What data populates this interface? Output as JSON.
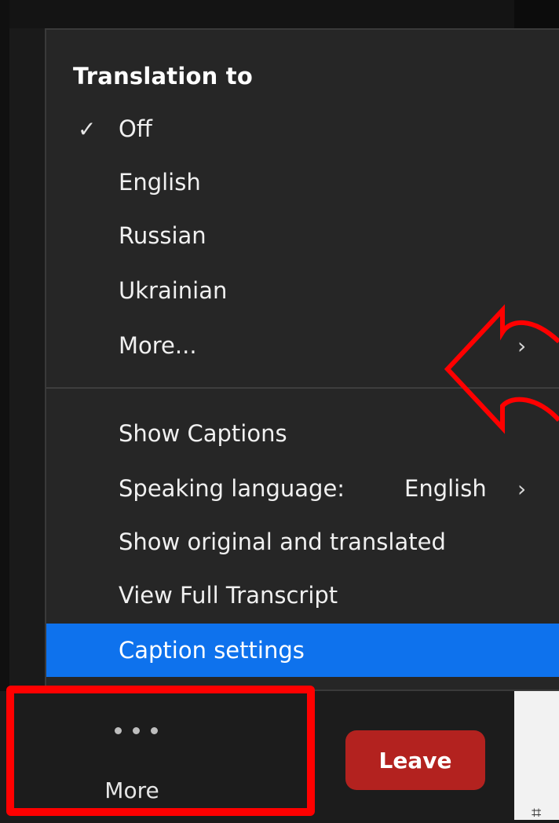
{
  "menu": {
    "header": "Translation to",
    "translation_options": [
      {
        "label": "Off",
        "checked": true
      },
      {
        "label": "English",
        "checked": false
      },
      {
        "label": "Russian",
        "checked": false
      },
      {
        "label": "Ukrainian",
        "checked": false
      },
      {
        "label": "More...",
        "checked": false,
        "has_submenu": true
      }
    ],
    "caption_items": [
      {
        "label": "Show Captions"
      },
      {
        "label": "Speaking language:",
        "value": "English",
        "has_submenu": true
      },
      {
        "label": "Show original and translated"
      },
      {
        "label": "View Full Transcript"
      },
      {
        "label": "Caption settings",
        "selected": true
      }
    ]
  },
  "toolbar": {
    "more_label": "More",
    "leave_label": "Leave"
  },
  "icons": {
    "checkmark": "✓",
    "chevron_right": "›",
    "more_icon": "ellipsis-horizontal",
    "corner_glyph": "⌗"
  },
  "colors": {
    "menu_bg": "#262626",
    "selected_bg": "#0e72ed",
    "leave_bg": "#b3221f",
    "annotation": "#ff0000"
  }
}
